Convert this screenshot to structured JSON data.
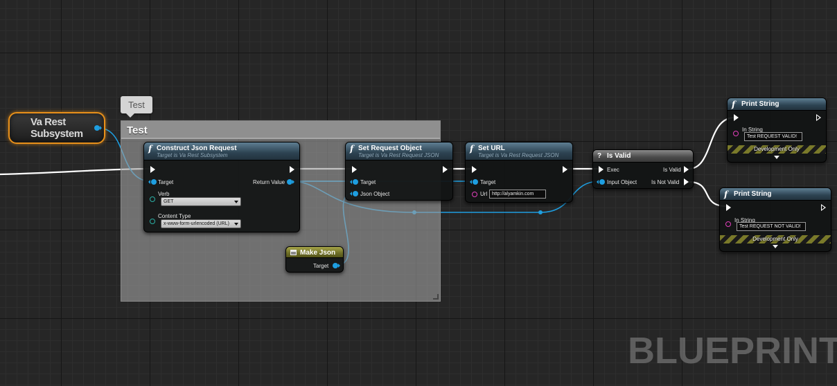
{
  "comment": {
    "bubble": "Test",
    "title": "Test"
  },
  "getter": {
    "label": "Va Rest Subsystem"
  },
  "nodes": {
    "construct": {
      "title": "Construct Json Request",
      "subtitle": "Target is Va Rest Subsystem",
      "pins": {
        "target": "Target",
        "return_value": "Return Value",
        "verb": "Verb",
        "content_type": "Content Type"
      },
      "verb_value": "GET",
      "content_type_value": "x-www-form-urlencoded (URL)"
    },
    "set_request": {
      "title": "Set Request Object",
      "subtitle": "Target is Va Rest Request JSON",
      "pins": {
        "target": "Target",
        "json_object": "Json Object"
      }
    },
    "set_url": {
      "title": "Set URL",
      "subtitle": "Target is Va Rest Request JSON",
      "pins": {
        "target": "Target",
        "url": "Url"
      },
      "url_value": "http://alyamkin.com"
    },
    "is_valid": {
      "title": "Is Valid",
      "pins": {
        "exec": "Exec",
        "input_object": "Input Object",
        "is_valid": "Is Valid",
        "is_not_valid": "Is Not Valid"
      }
    },
    "make_json": {
      "title": "Make Json",
      "pins": {
        "target": "Target"
      }
    },
    "print_valid": {
      "title": "Print String",
      "pins": {
        "in_string": "In String"
      },
      "in_string_value": "Test REQUEST VALID!",
      "dev_only": "Development Only"
    },
    "print_not_valid": {
      "title": "Print String",
      "pins": {
        "in_string": "In String"
      },
      "in_string_value": "Test REQUEST NOT VALID!",
      "dev_only": "Development Only"
    }
  },
  "watermark": "BLUEPRINT",
  "colors": {
    "exec_wire": "#ffffff",
    "object_wire": "#1e9ee0",
    "getter_border": "#e8901a",
    "string_pin": "#e33fbc"
  }
}
